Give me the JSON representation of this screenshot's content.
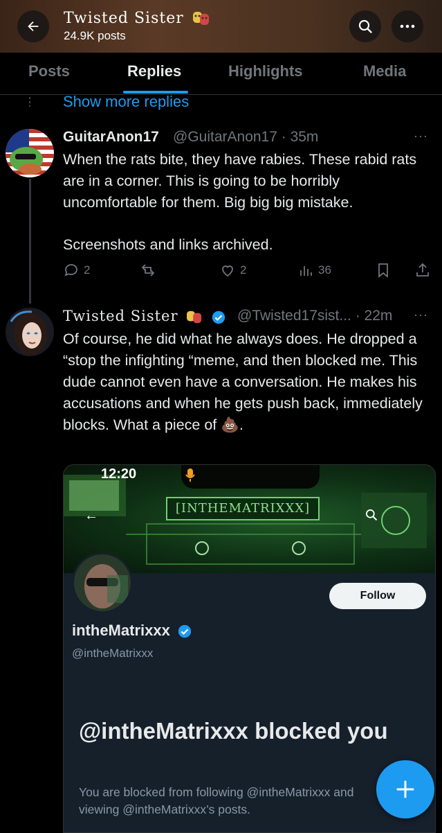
{
  "header": {
    "title": "Twisted Sister",
    "post_count": "24.9K posts"
  },
  "tabs": [
    {
      "label": "Posts"
    },
    {
      "label": "Replies"
    },
    {
      "label": "Highlights"
    },
    {
      "label": "Media"
    }
  ],
  "active_tab": "Replies",
  "thread": {
    "show_more": "Show more replies"
  },
  "posts": [
    {
      "display_name": "GuitarAnon17",
      "handle_time": "@GuitarAnon17 · 35m",
      "text_1": "When the rats bite, they have rabies. These rabid rats are in a corner. This is going to be horribly uncomfortable for them. Big big big mistake.",
      "text_2": "Screenshots and links archived.",
      "replies": "2",
      "likes": "2",
      "views": "36"
    },
    {
      "display_name": "Twisted Sister",
      "handle_time": "@Twisted17sist... · 22m",
      "text": "Of course, he did what he always does. He dropped a “stop the infighting “meme, and then blocked me. This dude cannot even have a conversation. He makes his accusations and when he gets push back, immediately blocks. What a piece of 💩."
    }
  ],
  "embed": {
    "status_time": "12:20",
    "banner_text": "[INTHEMATRIXXX]",
    "follow_label": "Follow",
    "profile_name": "intheMatrixxx",
    "profile_handle": "@intheMatrixxx",
    "blocked_title": "@intheMatrixxx blocked you",
    "blocked_text": "You are blocked from following @intheMatrixxx and viewing @intheMatrixxx’s posts."
  },
  "colors": {
    "accent": "#1d9bf0",
    "background": "#000000",
    "muted": "#71767b"
  },
  "icons": [
    "back-arrow-icon",
    "search-icon",
    "more-icon",
    "reply-icon",
    "repost-icon",
    "like-icon",
    "views-icon",
    "bookmark-icon",
    "share-icon",
    "verified-icon",
    "plus-icon"
  ]
}
